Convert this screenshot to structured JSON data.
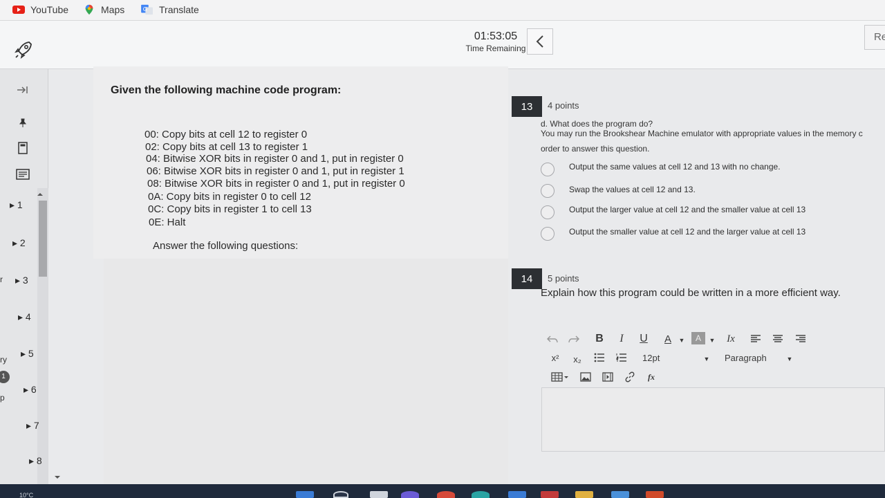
{
  "bookmarks": [
    {
      "label": "YouTube",
      "icon": "youtube-icon"
    },
    {
      "label": "Maps",
      "icon": "maps-pin-icon"
    },
    {
      "label": "Translate",
      "icon": "translate-icon"
    }
  ],
  "header": {
    "timer_value": "01:53:05",
    "timer_label": "Time Remaining",
    "review_label": "Re"
  },
  "nav": {
    "questions": [
      "1",
      "2",
      "3",
      "4",
      "5",
      "6",
      "7",
      "8"
    ],
    "edge_texts": [
      "r",
      "ry",
      "p"
    ],
    "badge": "1"
  },
  "passage": {
    "title": "Given the following machine code program:",
    "lines": [
      "00: Copy bits at cell 12 to register 0",
      "02: Copy bits at cell 13 to register 1",
      "04: Bitwise XOR bits in register 0 and 1, put in register 0",
      "06: Bitwise XOR bits in register 0 and 1, put in register 1",
      "08: Bitwise XOR bits in register 0 and 1, put in register 0",
      "0A: Copy bits in register 0 to cell 12",
      "0C: Copy bits in register 1 to cell 13",
      "0E: Halt"
    ],
    "footer": "Answer the following questions:"
  },
  "q13": {
    "number": "13",
    "points": "4 points",
    "prompt_line1": "d. What does the program do?",
    "prompt_line2": "You may run the Brookshear Machine emulator with appropriate values in the memory c",
    "prompt_line3": "order to answer this question.",
    "options": [
      "Output the same values at cell 12 and 13 with no change.",
      "Swap the values at cell 12 and 13.",
      "Output the larger value at cell 12 and the smaller value at cell 13",
      "Output the smaller value at cell 12 and the larger value at cell 13"
    ]
  },
  "q14": {
    "number": "14",
    "points": "5 points",
    "prompt": "Explain how this program could be written in a more efficient way."
  },
  "editor": {
    "bold": "B",
    "italic": "I",
    "underline": "U",
    "font_color": "A",
    "bg_color": "A",
    "clear_format": "Ix",
    "superscript": "x²",
    "subscript": "x₂",
    "font_size": "12pt",
    "block_format": "Paragraph",
    "formula": "fx"
  },
  "taskbar": {
    "temperature": "10°C"
  },
  "colors": {
    "qnum_bg": "#2c2f33",
    "taskbar_bg": "#1f2a3c",
    "youtube_red": "#e62117"
  }
}
